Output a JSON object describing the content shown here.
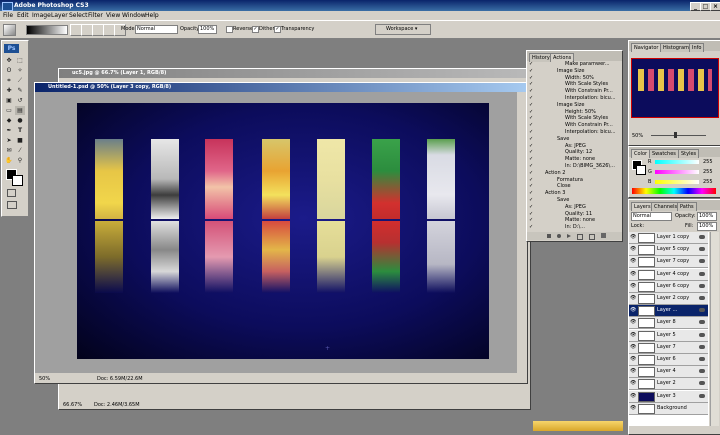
{
  "app": {
    "title": "Adobe Photoshop CS3",
    "icon": "photoshop-logo"
  },
  "menu": [
    "File",
    "Edit",
    "Image",
    "Layer",
    "Select",
    "Filter",
    "View",
    "Window",
    "Help"
  ],
  "options": {
    "mode_label": "Mode:",
    "mode_value": "Normal",
    "opacity_label": "Opacity:",
    "opacity_value": "100%",
    "reverse_label": "Reverse",
    "dither_label": "Dither",
    "transparency_label": "Transparency",
    "workspace_label": "Workspace ▾"
  },
  "toolbox": {
    "ps_logo": "Ps"
  },
  "documents": [
    {
      "title": "uc5.jpg @ 66.7% (Layer 1, RGB/8)",
      "zoom": "66.67%",
      "doc_size": "Doc: 2.46M/3.65M"
    },
    {
      "title": "Untitled-1.psd @ 50% (Layer 3 copy, RGB/8)",
      "zoom": "50%",
      "doc_size": "Doc: 6.59M/22.6M"
    }
  ],
  "actions_panel": {
    "tabs": [
      "History",
      "Actions"
    ],
    "lines": [
      "Make paramwer...",
      "Image Size",
      "Width: 50%",
      "With Scale Styles",
      "With Constrain Pr...",
      "Interpolation: bicu...",
      "Image Size",
      "Height: 50%",
      "With Scale Styles",
      "With Constrain Pr...",
      "Interpolation: bicu...",
      "Save",
      "As: JPEG",
      "Quality: 12",
      "Matte: none",
      "In: D:\\BIMG_3626\\...",
      "Action 2",
      "Formatura",
      "Close",
      "Action 3",
      "Save",
      "As: JPEG",
      "Quality: 11",
      "Matte: none",
      "In: D:\\..."
    ]
  },
  "navigator_panel": {
    "tabs": [
      "Navigator",
      "Histogram",
      "Info"
    ],
    "zoom": "50%"
  },
  "color_panel": {
    "tabs": [
      "Color",
      "Swatches",
      "Styles"
    ],
    "channels": [
      {
        "label": "R",
        "value": "255"
      },
      {
        "label": "G",
        "value": "255"
      },
      {
        "label": "B",
        "value": "255"
      }
    ]
  },
  "layers_panel": {
    "tabs": [
      "Layers",
      "Channels",
      "Paths"
    ],
    "blend_mode": "Normal",
    "opacity_label": "Opacity:",
    "opacity_value": "100%",
    "fill_label": "Fill:",
    "fill_value": "100%",
    "lock_label": "Lock:",
    "layers": [
      {
        "name": "Layer 1 copy",
        "selected": false
      },
      {
        "name": "Layer 5 copy",
        "selected": false
      },
      {
        "name": "Layer 7 copy",
        "selected": false
      },
      {
        "name": "Layer 4 copy",
        "selected": false
      },
      {
        "name": "Layer 6 copy",
        "selected": false
      },
      {
        "name": "Layer 2 copy",
        "selected": false
      },
      {
        "name": "Layer ...",
        "selected": true
      },
      {
        "name": "Layer 8",
        "selected": false
      },
      {
        "name": "Layer 5",
        "selected": false
      },
      {
        "name": "Layer 7",
        "selected": false
      },
      {
        "name": "Layer 6",
        "selected": false
      },
      {
        "name": "Layer 4",
        "selected": false
      },
      {
        "name": "Layer 2",
        "selected": false
      },
      {
        "name": "Layer 3",
        "selected": false
      },
      {
        "name": "Background",
        "selected": false
      }
    ]
  },
  "colors": {
    "canvas": "#0c0c5c",
    "accent": "#0a246a",
    "chrome": "#d4d0c8"
  }
}
